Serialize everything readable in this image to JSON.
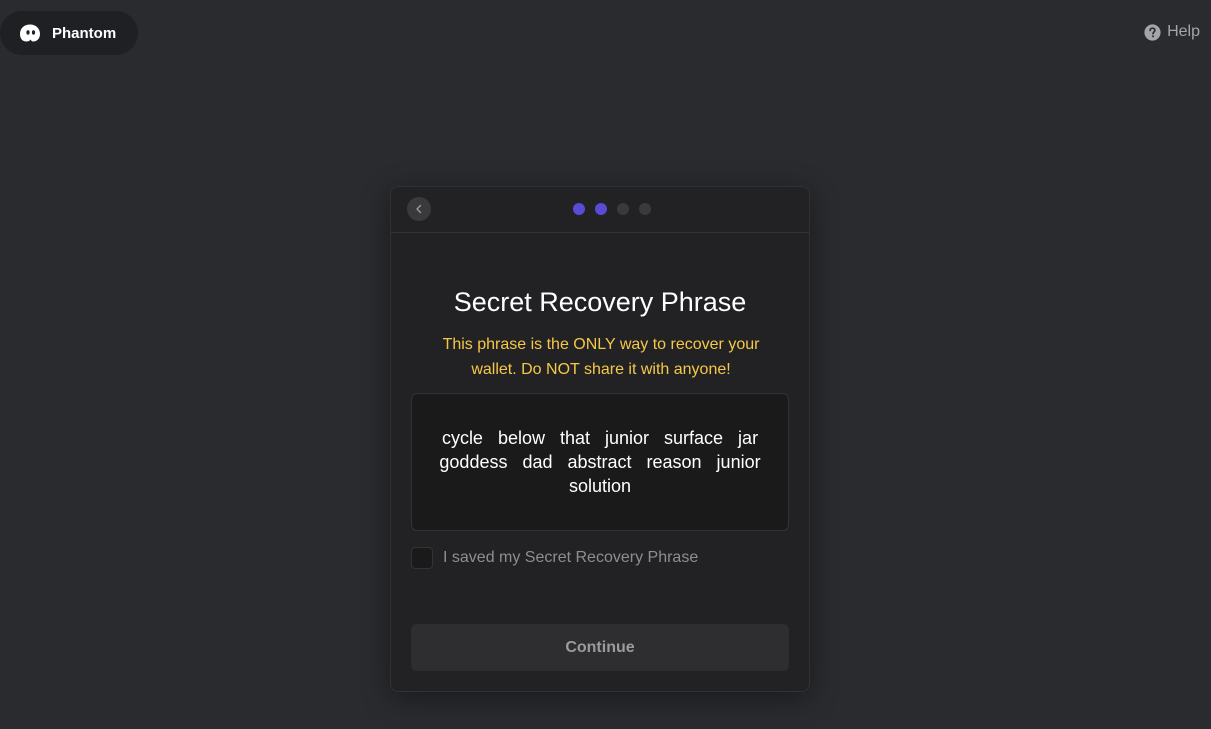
{
  "header": {
    "brand_name": "Phantom",
    "help_label": "Help"
  },
  "card": {
    "back_icon": "chevron-left-icon",
    "steps": {
      "total": 4,
      "active": 2
    },
    "title": "Secret Recovery Phrase",
    "warning": "This phrase is the ONLY way to recover your wallet. Do NOT share it with anyone!",
    "phrase": "cycle below that junior surface jar goddess dad abstract reason junior solution",
    "checkbox_label": "I saved my Secret Recovery Phrase",
    "checkbox_checked": false,
    "continue_label": "Continue"
  },
  "colors": {
    "background": "#2a2b2f",
    "accent": "#5a4bd6",
    "warning": "#f5c847"
  }
}
